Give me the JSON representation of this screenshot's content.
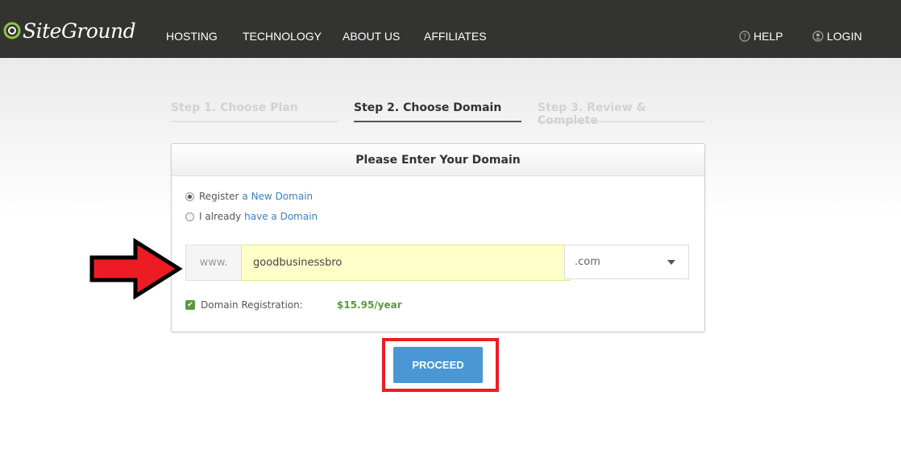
{
  "header": {
    "logo_text": "SiteGround",
    "nav": [
      "HOSTING",
      "TECHNOLOGY",
      "ABOUT US",
      "AFFILIATES"
    ],
    "help_label": "HELP",
    "login_label": "LOGIN"
  },
  "steps": [
    {
      "label": "Step 1. Choose Plan",
      "state": "inactive"
    },
    {
      "label": "Step 2. Choose Domain",
      "state": "active"
    },
    {
      "label": "Step 3. Review & Complete",
      "state": "inactive"
    }
  ],
  "panel": {
    "title": "Please Enter Your Domain",
    "option_register": {
      "prefix": "Register",
      "link": "a New Domain",
      "selected": true
    },
    "option_existing": {
      "prefix": "I already",
      "link": "have a Domain",
      "selected": false
    },
    "www_label": "www.",
    "domain_value": "goodbusinessbro",
    "tld_selected": ".com",
    "registration_label": "Domain Registration:",
    "registration_checked": true,
    "registration_price": "$15.95/year"
  },
  "proceed_label": "PROCEED",
  "colors": {
    "topbar": "#333332",
    "accent_blue": "#4a97d6",
    "price_green": "#5a9a3c",
    "annotation_red": "#ed1c24"
  },
  "icons": [
    "siteground-logo-icon",
    "help-icon",
    "user-icon",
    "chevron-down-icon",
    "checkmark-icon",
    "red-arrow-annotation"
  ]
}
